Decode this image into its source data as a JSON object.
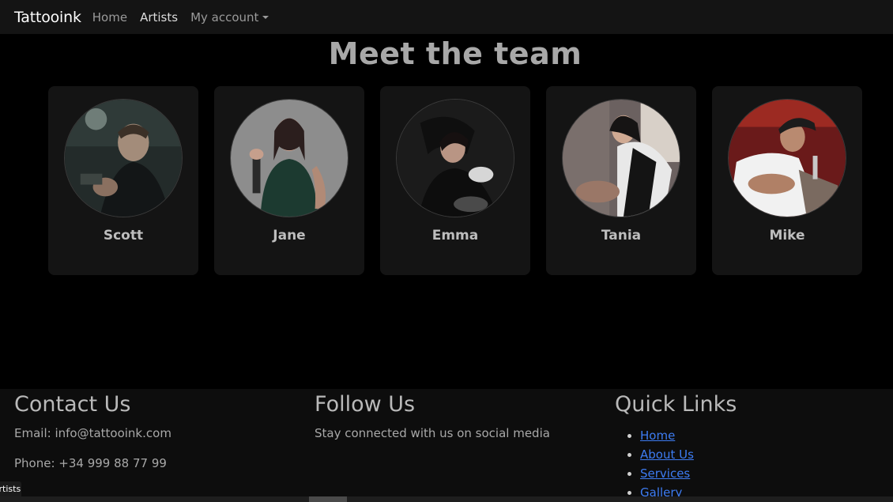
{
  "navbar": {
    "brand": "Tattooink",
    "links": [
      {
        "label": "Home"
      },
      {
        "label": "Artists"
      },
      {
        "label": "My account"
      }
    ]
  },
  "team": {
    "title": "Meet the team",
    "artists": [
      {
        "name": "Scott"
      },
      {
        "name": "Jane"
      },
      {
        "name": "Emma"
      },
      {
        "name": "Tania"
      },
      {
        "name": "Mike"
      }
    ]
  },
  "footer": {
    "contact": {
      "title": "Contact Us",
      "email": "Email: info@tattooink.com",
      "phone": "Phone: +34 999 88 77 99"
    },
    "follow": {
      "title": "Follow Us",
      "text": "Stay connected with us on social media"
    },
    "quick_links": {
      "title": "Quick Links",
      "items": [
        "Home",
        "About Us",
        "Services",
        "Gallery"
      ]
    }
  },
  "status_bar": {
    "url_tooltip": "Artists"
  },
  "colors": {
    "page_bg": "#000000",
    "navbar_bg": "#141414",
    "card_bg": "#141414",
    "footer_bg": "#0d0d0d",
    "link": "#3d7cf2"
  }
}
